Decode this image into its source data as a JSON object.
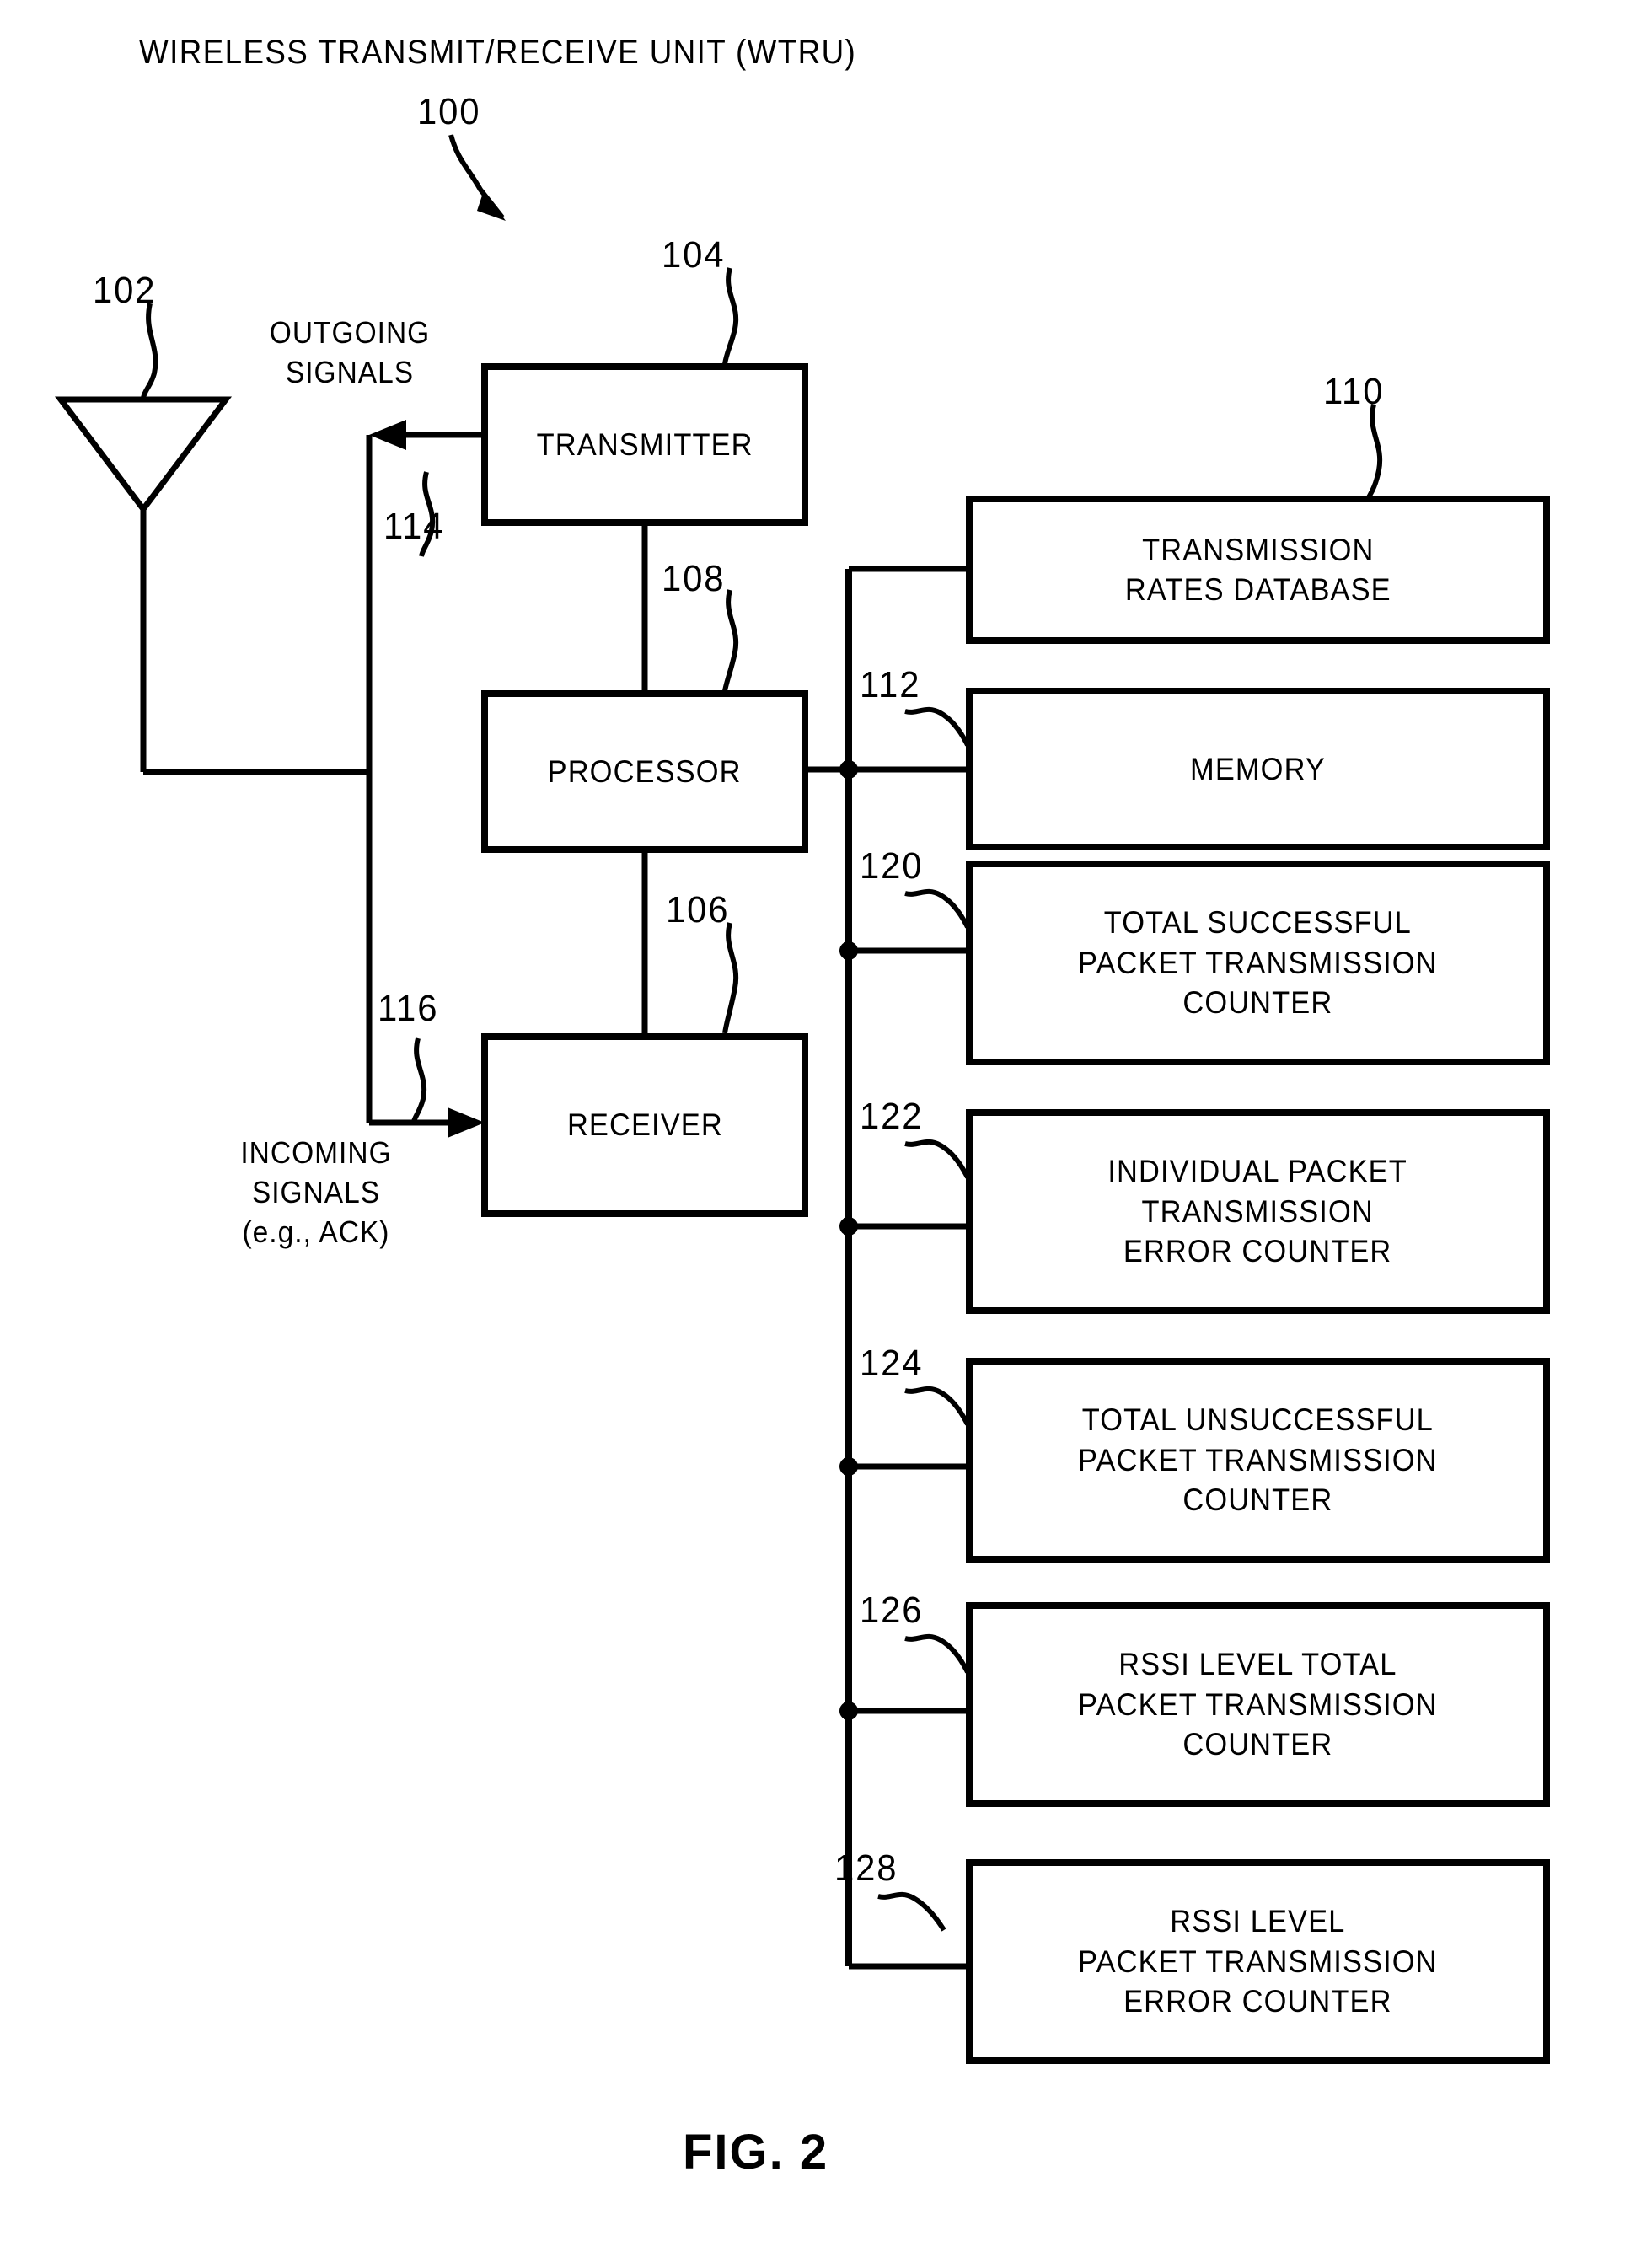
{
  "figure": {
    "title": "WIRELESS TRANSMIT/RECEIVE UNIT (WTRU)",
    "caption": "FIG. 2",
    "system_ref": "100",
    "ink_color": "#000000",
    "background_color": "#ffffff"
  },
  "annotations": {
    "outgoing_signals_line1": "OUTGOING",
    "outgoing_signals_line2": "SIGNALS",
    "incoming_signals_line1": "INCOMING",
    "incoming_signals_line2": "SIGNALS",
    "incoming_signals_line3": "(e.g.,  ACK)"
  },
  "refs": {
    "antenna": "102",
    "transmitter": "104",
    "receiver": "106",
    "processor": "108",
    "transmission_rates_database": "110",
    "memory": "112",
    "transmitter_path": "114",
    "receiver_path": "116",
    "total_successful_counter": "120",
    "individual_error_counter": "122",
    "total_unsuccessful_counter": "124",
    "rssi_total_counter": "126",
    "rssi_error_counter": "128"
  },
  "core_blocks": [
    {
      "id": "transmitter",
      "ref": "104",
      "lines": [
        "TRANSMITTER"
      ]
    },
    {
      "id": "processor",
      "ref": "108",
      "lines": [
        "PROCESSOR"
      ]
    },
    {
      "id": "receiver",
      "ref": "106",
      "lines": [
        "RECEIVER"
      ]
    }
  ],
  "memory_blocks": [
    {
      "id": "transmission-rates-database",
      "ref": "110",
      "lines": [
        "TRANSMISSION",
        "RATES  DATABASE"
      ]
    },
    {
      "id": "memory",
      "ref": "112",
      "lines": [
        "MEMORY"
      ]
    },
    {
      "id": "total-successful-packet-transmission-counter",
      "ref": "120",
      "lines": [
        "TOTAL  SUCCESSFUL",
        "PACKET  TRANSMISSION",
        "COUNTER"
      ]
    },
    {
      "id": "individual-packet-transmission-error-counter",
      "ref": "122",
      "lines": [
        "INDIVIDUAL  PACKET",
        "TRANSMISSION",
        "ERROR  COUNTER"
      ]
    },
    {
      "id": "total-unsuccessful-packet-transmission-counter",
      "ref": "124",
      "lines": [
        "TOTAL  UNSUCCESSFUL",
        "PACKET  TRANSMISSION",
        "COUNTER"
      ]
    },
    {
      "id": "rssi-level-total-packet-transmission-counter",
      "ref": "126",
      "lines": [
        "RSSI  LEVEL  TOTAL",
        "PACKET  TRANSMISSION",
        "COUNTER"
      ]
    },
    {
      "id": "rssi-level-packet-transmission-error-counter",
      "ref": "128",
      "lines": [
        "RSSI  LEVEL",
        "PACKET  TRANSMISSION",
        "ERROR  COUNTER"
      ]
    }
  ],
  "block_text": {
    "transmitter": "TRANSMITTER",
    "processor": "PROCESSOR",
    "receiver": "RECEIVER",
    "db_l1": "TRANSMISSION",
    "db_l2": "RATES  DATABASE",
    "memory": "MEMORY",
    "b120_l1": "TOTAL  SUCCESSFUL",
    "b120_l2": "PACKET  TRANSMISSION",
    "b120_l3": "COUNTER",
    "b122_l1": "INDIVIDUAL  PACKET",
    "b122_l2": "TRANSMISSION",
    "b122_l3": "ERROR  COUNTER",
    "b124_l1": "TOTAL  UNSUCCESSFUL",
    "b124_l2": "PACKET  TRANSMISSION",
    "b124_l3": "COUNTER",
    "b126_l1": "RSSI  LEVEL  TOTAL",
    "b126_l2": "PACKET  TRANSMISSION",
    "b126_l3": "COUNTER",
    "b128_l1": "RSSI  LEVEL",
    "b128_l2": "PACKET  TRANSMISSION",
    "b128_l3": "ERROR  COUNTER"
  }
}
